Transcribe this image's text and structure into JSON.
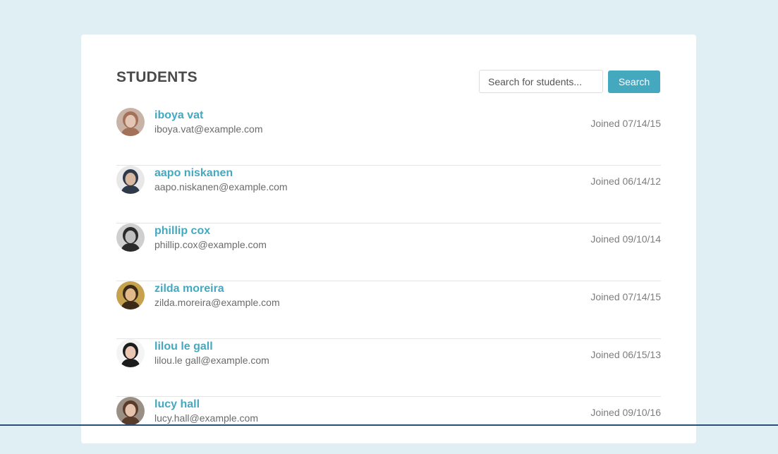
{
  "header": {
    "title": "STUDENTS",
    "search_placeholder": "Search for students...",
    "search_button": "Search"
  },
  "colors": {
    "accent": "#44a8bf",
    "background": "#dfeff3"
  },
  "students": [
    {
      "name": "iboya vat",
      "email": "iboya.vat@example.com",
      "joined": "Joined 07/14/15",
      "avatar_colors": [
        "#c9b3a6",
        "#a3705a",
        "#e3c7b4"
      ]
    },
    {
      "name": "aapo niskanen",
      "email": "aapo.niskanen@example.com",
      "joined": "Joined 06/14/12",
      "avatar_colors": [
        "#e8e8e8",
        "#2e3a4a",
        "#d9b8a0"
      ]
    },
    {
      "name": "phillip cox",
      "email": "phillip.cox@example.com",
      "joined": "Joined 09/10/14",
      "avatar_colors": [
        "#cfcfcf",
        "#2a2a2a",
        "#bfbfbf"
      ]
    },
    {
      "name": "zilda moreira",
      "email": "zilda.moreira@example.com",
      "joined": "Joined 07/14/15",
      "avatar_colors": [
        "#c7a24e",
        "#3b2a18",
        "#e2b98a"
      ]
    },
    {
      "name": "lilou le gall",
      "email": "lilou.le gall@example.com",
      "joined": "Joined 06/15/13",
      "avatar_colors": [
        "#f4f4f4",
        "#1c1c1c",
        "#e9c7b3"
      ]
    },
    {
      "name": "lucy hall",
      "email": "lucy.hall@example.com",
      "joined": "Joined 09/10/16",
      "avatar_colors": [
        "#9a8f85",
        "#5a3b2a",
        "#e6c3ad"
      ]
    }
  ]
}
